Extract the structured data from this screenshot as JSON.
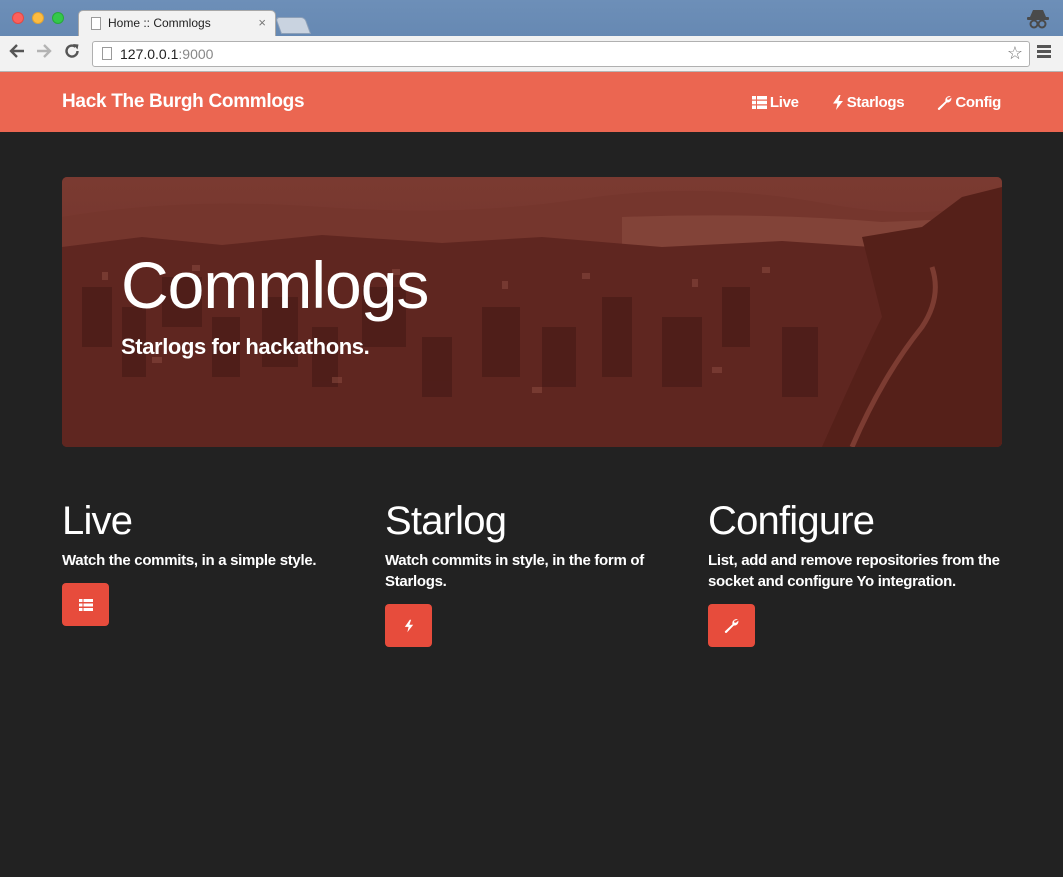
{
  "browser": {
    "tab_title": "Home :: Commlogs",
    "tab_close": "×",
    "url_host": "127.0.0.1",
    "url_port": ":9000",
    "icons": [
      "back-arrow-icon",
      "forward-arrow-icon",
      "reload-icon",
      "page-icon",
      "star-icon",
      "menu-icon",
      "incognito-icon"
    ]
  },
  "navbar": {
    "brand": "Hack The Burgh Commlogs",
    "links": [
      {
        "label": "Live",
        "icon": "list-icon"
      },
      {
        "label": "Starlogs",
        "icon": "bolt-icon"
      },
      {
        "label": "Config",
        "icon": "wrench-icon"
      }
    ]
  },
  "hero": {
    "title": "Commlogs",
    "subtitle": "Starlogs for hackathons."
  },
  "features": [
    {
      "title": "Live",
      "text": "Watch the commits, in a simple style.",
      "icon": "list-icon"
    },
    {
      "title": "Starlog",
      "text": "Watch commits in style, in the form of Starlogs.",
      "icon": "bolt-icon"
    },
    {
      "title": "Configure",
      "text": "List, add and remove repositories from the socket and configure Yo integration.",
      "icon": "wrench-icon"
    }
  ],
  "colors": {
    "navbar": "#eb6651",
    "background": "#222222",
    "hero_tint": "#6a2c24",
    "button": "#e74c3c"
  }
}
